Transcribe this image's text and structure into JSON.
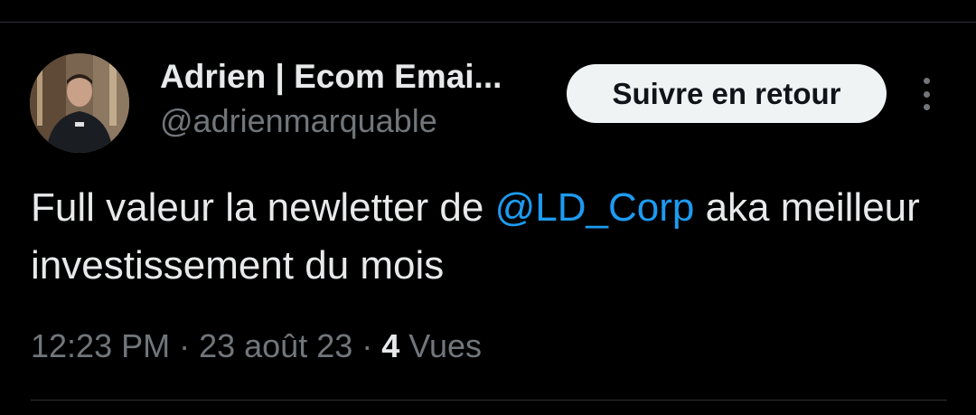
{
  "author": {
    "display_name": "Adrien | Ecom Emai...",
    "handle": "@adrienmarquable",
    "avatar_icon": "profile-photo"
  },
  "follow_button": {
    "label": "Suivre en retour"
  },
  "menu": {
    "icon": "more-vertical-icon"
  },
  "tweet": {
    "text_before": "Full valeur la newletter de ",
    "mention": "@LD_Corp",
    "text_after": " aka meilleur investissement du mois"
  },
  "meta": {
    "time": "12:23 PM",
    "separator_1": " · ",
    "date": "23 août 23",
    "separator_2": " · ",
    "views_count": "4",
    "views_label": " Vues"
  },
  "colors": {
    "background": "#000000",
    "text": "#e7e9ea",
    "secondary_text": "#71767b",
    "link": "#1d9bf0",
    "button_bg": "#eff3f4",
    "divider": "#2f3336"
  }
}
